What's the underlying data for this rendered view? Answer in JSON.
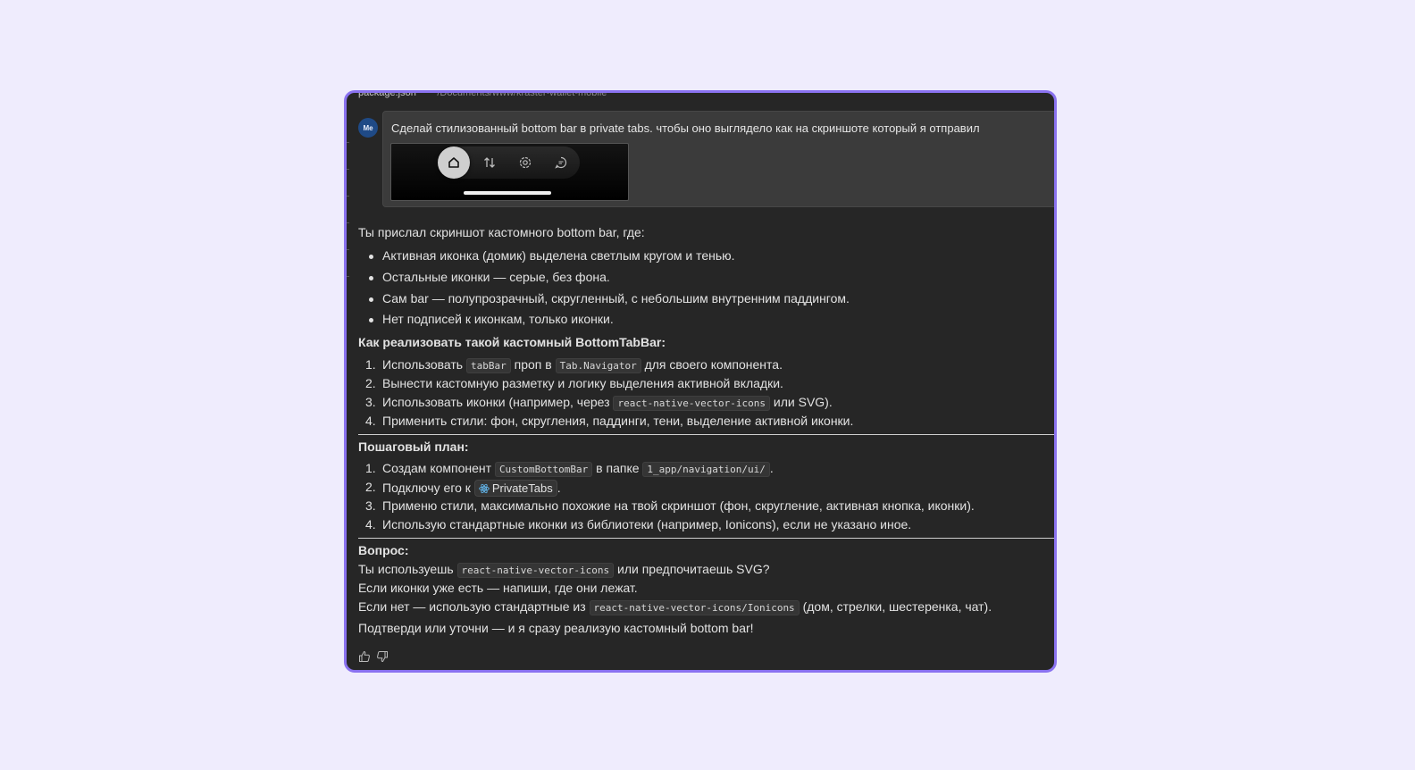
{
  "header": {
    "file_name": "package.json",
    "file_path": "~/Documents/www/kraster-wallet-mobile"
  },
  "user_message": {
    "avatar": "Me",
    "text": "Сделай стилизованный bottom bar в private tabs. чтобы оно выглядело как на скриншоте который я отправил",
    "attachment": {
      "tabs": [
        "home-icon",
        "arrows-updown-icon",
        "gear-icon",
        "chat-icon"
      ],
      "active_tab": 0
    }
  },
  "response": {
    "intro": "Ты прислал скриншот кастомного bottom bar, где:",
    "bullets": [
      "Активная иконка (домик) выделена светлым кругом и тенью.",
      "Остальные иконки — серые, без фона.",
      "Сам bar — полупрозрачный, скругленный, с небольшим внутренним паддингом.",
      "Нет подписей к иконкам, только иконки."
    ],
    "how_heading": "Как реализовать такой кастомный BottomTabBar:",
    "how_items": [
      {
        "n": "1.",
        "a": "Использовать ",
        "code1": "tabBar",
        "b": " проп в ",
        "code2": "Tab.Navigator",
        "c": " для своего компонента."
      },
      {
        "n": "2.",
        "a": "Вынести кастомную разметку и логику выделения активной вкладки."
      },
      {
        "n": "3.",
        "a": "Использовать иконки (например, через ",
        "code1": "react-native-vector-icons",
        "b": " или SVG)."
      },
      {
        "n": "4.",
        "a": "Применить стили: фон, скругления, паддинги, тени, выделение активной иконки."
      }
    ],
    "plan_heading": "Пошаговый план:",
    "plan_items": [
      {
        "n": "1.",
        "a": "Создам компонент ",
        "code1": "CustomBottomBar",
        "b": " в папке ",
        "code2": "1_app/navigation/ui/",
        "c": "."
      },
      {
        "n": "2.",
        "a": "Подключу его к ",
        "chip": "PrivateTabs",
        "b": "."
      },
      {
        "n": "3.",
        "a": "Применю стили, максимально похожие на твой скриншот (фон, скругление, активная кнопка, иконки)."
      },
      {
        "n": "4.",
        "a": "Использую стандартные иконки из библиотеки (например, Ionicons), если не указано иное."
      }
    ],
    "question_heading": "Вопрос:",
    "q_line1_a": "Ты используешь ",
    "q_line1_code": "react-native-vector-icons",
    "q_line1_b": " или предпочитаешь SVG?",
    "q_line2": "Если иконки уже есть — напиши, где они лежат.",
    "q_line3_a": "Если нет — использую стандартные из ",
    "q_line3_code": "react-native-vector-icons/Ionicons",
    "q_line3_b": " (дом, стрелки, шестеренка, чат).",
    "closing": "Подтверди или уточни — и я сразу реализую кастомный bottom bar!"
  },
  "feedback": {
    "like_icon": "thumbs-up-icon",
    "dislike_icon": "thumbs-down-icon"
  },
  "colors": {
    "accent_border": "#8a72f0",
    "panel_bg": "#262626",
    "page_bg": "#efecfd"
  }
}
